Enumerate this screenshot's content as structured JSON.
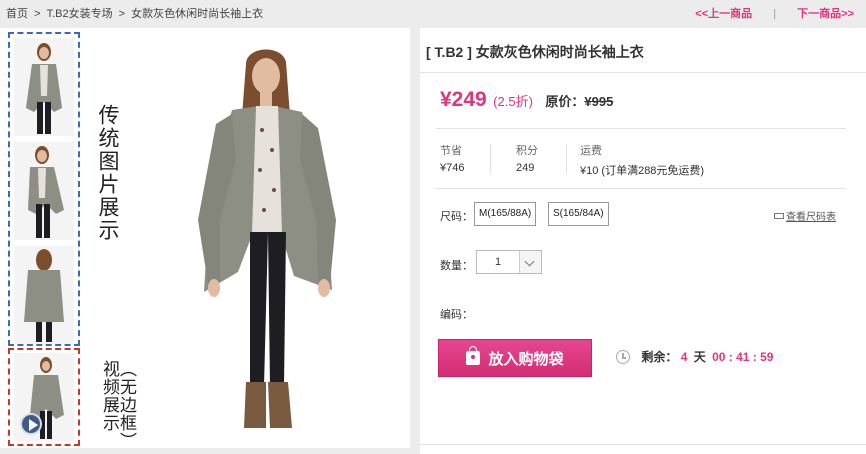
{
  "breadcrumb": {
    "home": "首页",
    "separator": ">",
    "category": "T.B2女装专场",
    "current": "女款灰色休闲时尚长袖上衣"
  },
  "pager": {
    "prev": "<<上一商品",
    "divider": "|",
    "next": "下一商品>>"
  },
  "gallery": {
    "traditional_label": "传统图片展示",
    "video_label": "（无边框）视频展示"
  },
  "product": {
    "title": "[ T.B2 ] 女款灰色休闲时尚长袖上衣",
    "price": "¥249",
    "discount": "(2.5折)",
    "original_label": "原价：",
    "original_price": "¥995",
    "savings_label": "节省",
    "savings_value": "¥746",
    "points_label": "积分",
    "points_value": "249",
    "shipping_label": "运费",
    "shipping_value": "¥10 (订单满288元免运费)",
    "size_label": "尺码：",
    "sizes": [
      "M(165/88A)",
      "S(165/84A)"
    ],
    "size_chart": "查看尺码表",
    "qty_label": "数量：",
    "qty_value": "1",
    "code_label": "编码：",
    "cart_button": "放入购物袋",
    "countdown": {
      "label": "剩余：",
      "days": "4",
      "days_unit": "天",
      "time": "00 : 41 : 59"
    }
  },
  "colors": {
    "accent": "#e0347f",
    "thumb_border": "#3b6bb4",
    "video_border": "#c0392b",
    "coat": "#8e8f84",
    "pants": "#1e1e22",
    "boots": "#7a5a3e",
    "skin": "#e2bca0",
    "hair": "#7a4e2e"
  }
}
